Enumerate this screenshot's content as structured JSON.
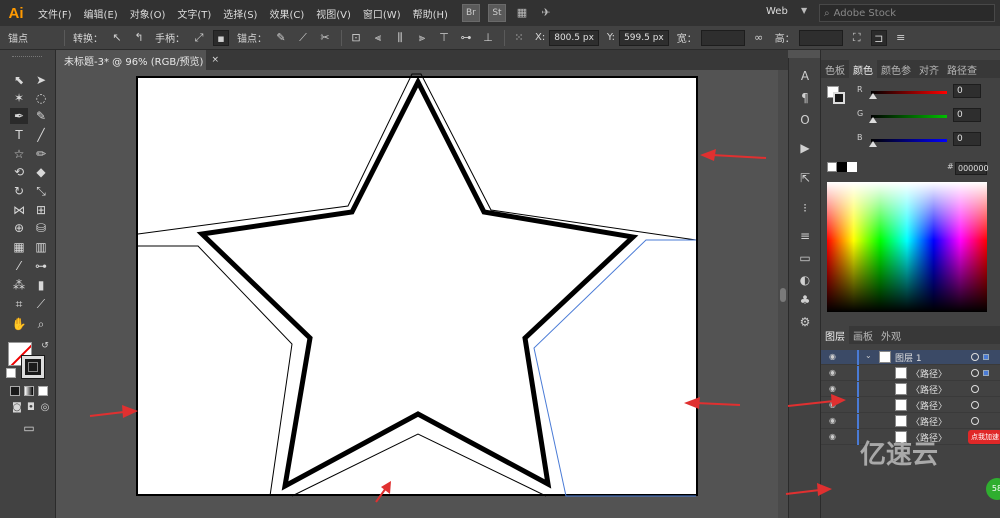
{
  "app": {
    "logo": "Ai",
    "menus": [
      "文件(F)",
      "编辑(E)",
      "对象(O)",
      "文字(T)",
      "选择(S)",
      "效果(C)",
      "视图(V)",
      "窗口(W)",
      "帮助(H)"
    ],
    "badges": [
      "Br",
      "St"
    ],
    "workspace": "Web",
    "search_placeholder": "Adobe Stock"
  },
  "control_bar": {
    "anchor_label": "锚点",
    "convert_label": "转换：",
    "handles_label": "手柄：",
    "anchors_label": "锚点：",
    "x_label": "X:",
    "x_value": "800.5 px",
    "y_label": "Y:",
    "y_value": "599.5 px",
    "w_label": "宽：",
    "h_label": "高："
  },
  "document": {
    "tab_title": "未标题-3* @ 96% (RGB/预览)",
    "tab_close": "×"
  },
  "color_panel": {
    "tabs": [
      "色板",
      "颜色",
      "颜色参",
      "对齐",
      "路径查"
    ],
    "active_tab": "颜色",
    "channels": [
      {
        "name": "R",
        "value": "0",
        "color": "#ff0000"
      },
      {
        "name": "G",
        "value": "0",
        "color": "#00c000"
      },
      {
        "name": "B",
        "value": "0",
        "color": "#0000ff"
      }
    ],
    "hex_symbol": "#",
    "hex_value": "000000"
  },
  "layers_panel": {
    "tabs": [
      "图层",
      "画板",
      "外观"
    ],
    "active_tab": "图层",
    "layer_name": "图层 1",
    "paths": [
      "〈路径〉",
      "〈路径〉",
      "〈路径〉",
      "〈路径〉",
      "〈路径〉"
    ]
  },
  "watermark": {
    "text": "亿速云",
    "badge": "点我加速",
    "round": "58"
  },
  "colors": {
    "annotation_arrow": "#e03030",
    "selection_blue": "#4a7bd6",
    "accent_orange": "#ff9a00"
  },
  "icons": {
    "tools": [
      "selection-icon",
      "direct-selection-icon",
      "magic-wand-icon",
      "lasso-icon",
      "pen-icon",
      "curvature-icon",
      "type-icon",
      "line-icon",
      "rectangle-icon",
      "paintbrush-icon",
      "shaper-icon",
      "eraser-icon",
      "rotate-icon",
      "scale-icon",
      "width-icon",
      "free-transform-icon",
      "shape-builder-icon",
      "live-paint-icon",
      "perspective-grid-icon",
      "mesh-icon",
      "gradient-icon",
      "eyedropper-icon",
      "blend-icon",
      "symbol-sprayer-icon",
      "graph-icon",
      "artboard-icon",
      "slice-icon",
      "hand-icon",
      "zoom-icon"
    ]
  }
}
